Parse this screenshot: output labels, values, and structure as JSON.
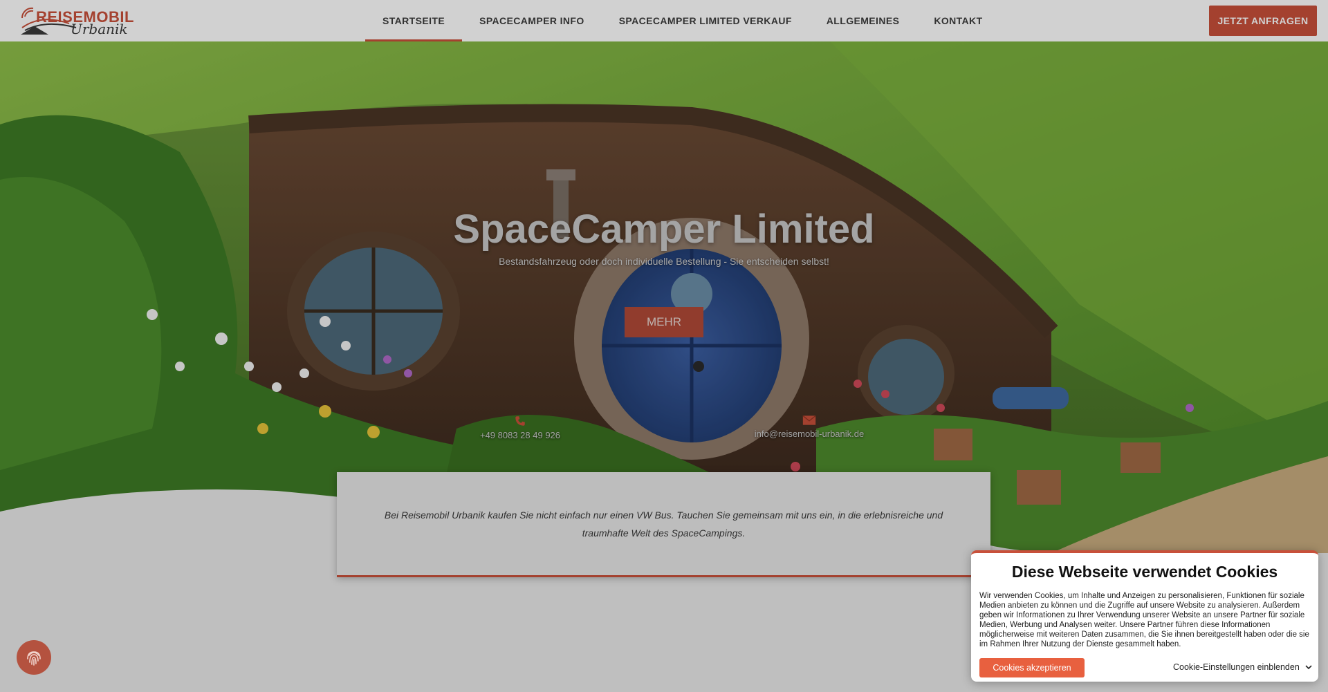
{
  "header": {
    "logo_brand": "REISEMOBIL",
    "logo_script": "Urbanik",
    "nav": [
      "STARTSEITE",
      "SPACECAMPER INFO",
      "SPACECAMPER LIMITED VERKAUF",
      "ALLGEMEINES",
      "KONTAKT"
    ],
    "active_nav": "STARTSEITE",
    "cta_label": "JETZT ANFRAGEN"
  },
  "hero": {
    "title": "SpaceCamper Limited",
    "subtitle": "Bestandsfahrzeug oder doch individuelle Bestellung - Sie entscheiden selbst!",
    "button_label": "MEHR",
    "phone": "+49 8083 28 49 926",
    "email": "info@reisemobil-urbanik.de"
  },
  "info_card": {
    "text": "Bei Reisemobil Urbanik kaufen Sie nicht einfach nur einen VW Bus. Tauchen Sie gemeinsam mit uns ein, in die erlebnisreiche und traumhafte Welt des SpaceCampings."
  },
  "cookie": {
    "title": "Diese Webseite verwendet Cookies",
    "text": "Wir verwenden Cookies, um Inhalte und Anzeigen zu personalisieren, Funktionen für soziale Medien anbieten zu können und die Zugriffe auf unsere Website zu analysieren. Außerdem geben wir Informationen zu Ihrer Verwendung unserer Website an unsere Partner für soziale Medien, Werbung und Analysen weiter. Unsere Partner führen diese Informationen möglicherweise mit weiteren Daten zusammen, die Sie ihnen bereitgestellt haben oder die sie im Rahmen Ihrer Nutzung der Dienste gesammelt haben.",
    "accept_label": "Cookies akzeptieren",
    "settings_label": "Cookie-Einstellungen einblenden"
  },
  "colors": {
    "accent": "#c8503a",
    "accept_button": "#e8603f",
    "grass": "#5e8f2e",
    "door_blue": "#2f4f8a"
  },
  "icons": [
    "phone-icon",
    "mail-icon",
    "fingerprint-icon",
    "chevron-down-icon"
  ]
}
